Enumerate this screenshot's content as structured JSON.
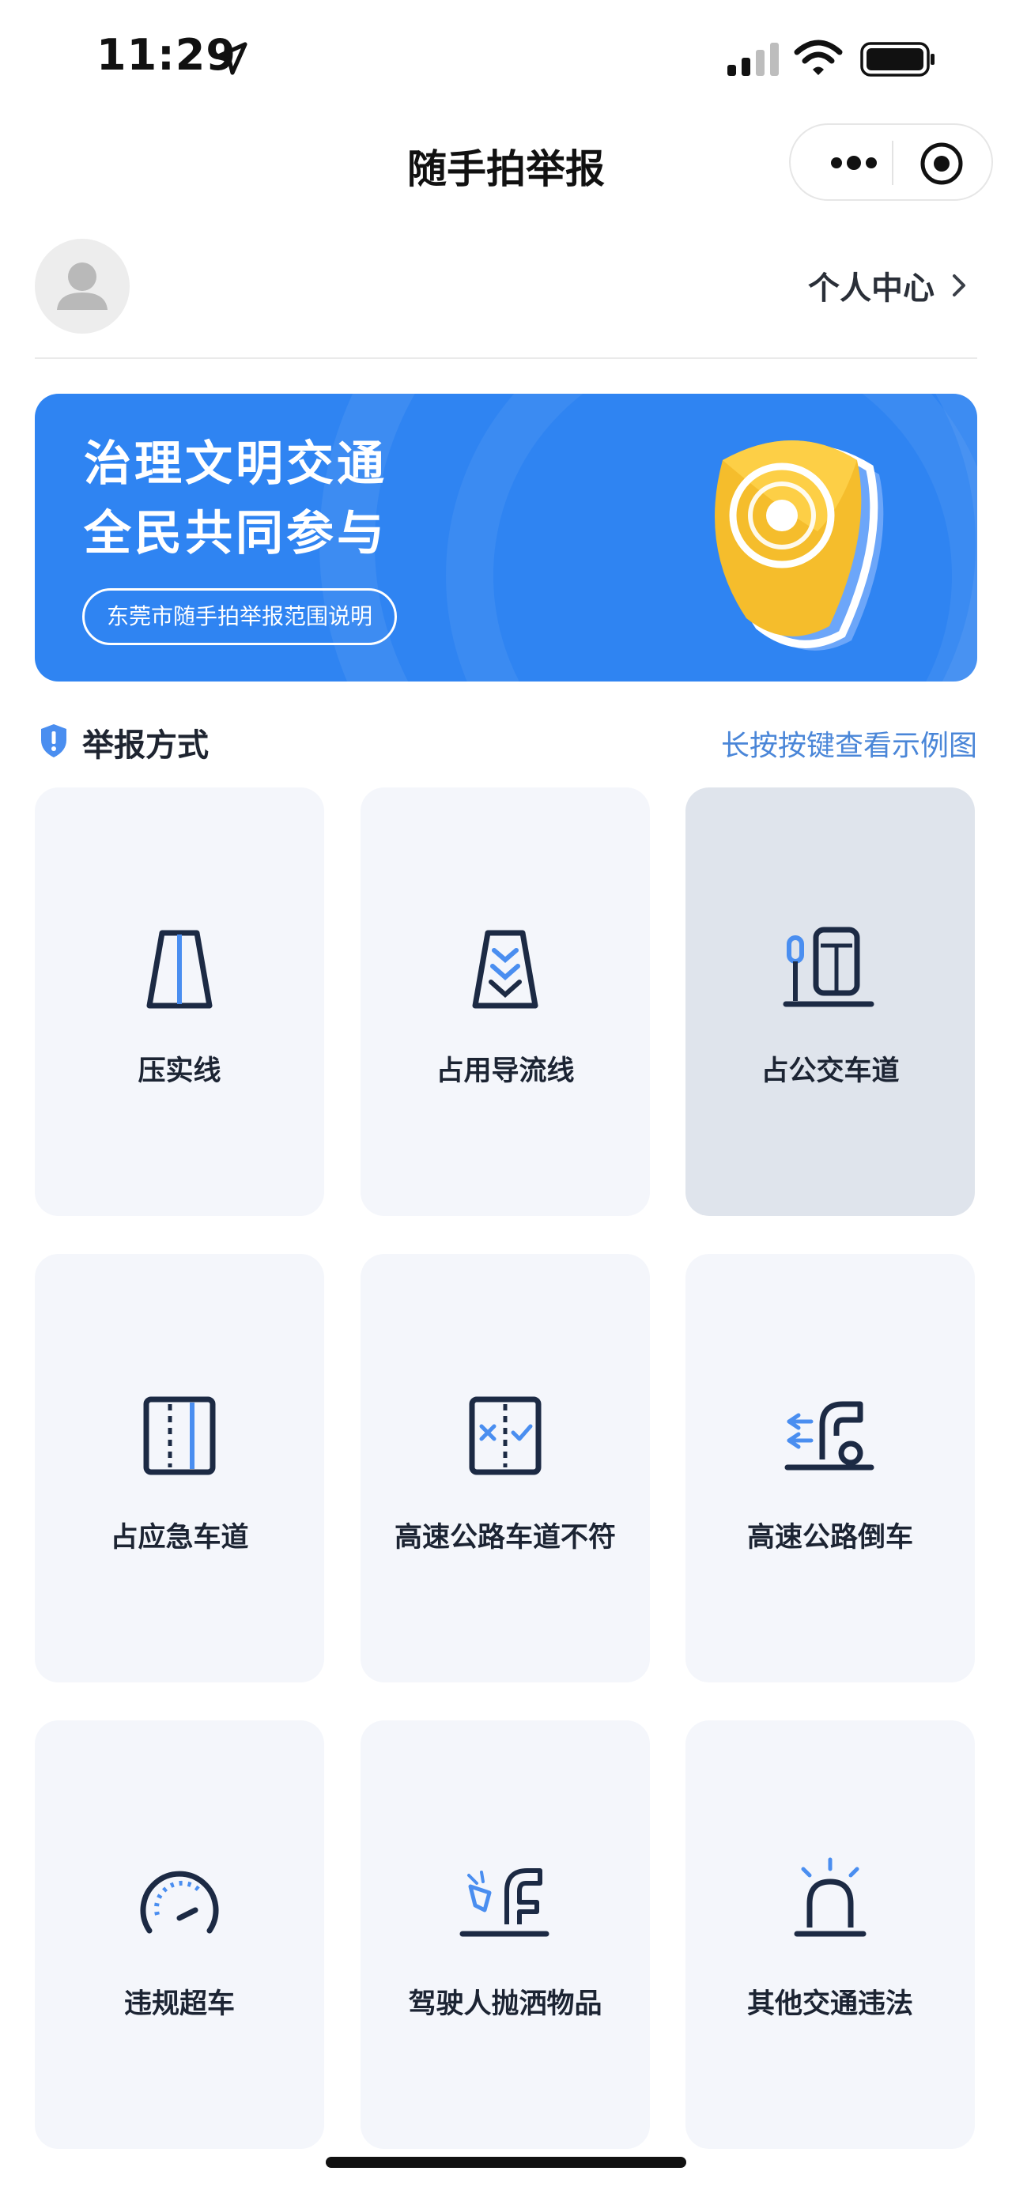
{
  "status": {
    "time": "11:29"
  },
  "nav": {
    "title": "随手拍举报"
  },
  "user": {
    "center_label": "个人中心"
  },
  "banner": {
    "line1": "治理文明交通",
    "line2": "全民共同参与",
    "link": "东莞市随手拍举报范围说明"
  },
  "section": {
    "title": "举报方式",
    "hint": "长按按键查看示例图"
  },
  "items": [
    {
      "label": "压实线",
      "icon": "solid-line-icon"
    },
    {
      "label": "占用导流线",
      "icon": "diversion-line-icon"
    },
    {
      "label": "占公交车道",
      "icon": "bus-lane-icon"
    },
    {
      "label": "占应急车道",
      "icon": "emergency-lane-icon"
    },
    {
      "label": "高速公路车道不符",
      "icon": "lane-mismatch-icon"
    },
    {
      "label": "高速公路倒车",
      "icon": "reversing-icon"
    },
    {
      "label": "违规超车",
      "icon": "speedometer-icon"
    },
    {
      "label": "驾驶人抛洒物品",
      "icon": "littering-icon"
    },
    {
      "label": "其他交通违法",
      "icon": "alarm-light-icon"
    }
  ],
  "colors": {
    "accent": "#2f84f2",
    "icon_dark": "#1c2a44",
    "icon_blue": "#4a8ef0",
    "card_bg": "#f4f6fb",
    "card_selected": "#dfe4ec"
  }
}
